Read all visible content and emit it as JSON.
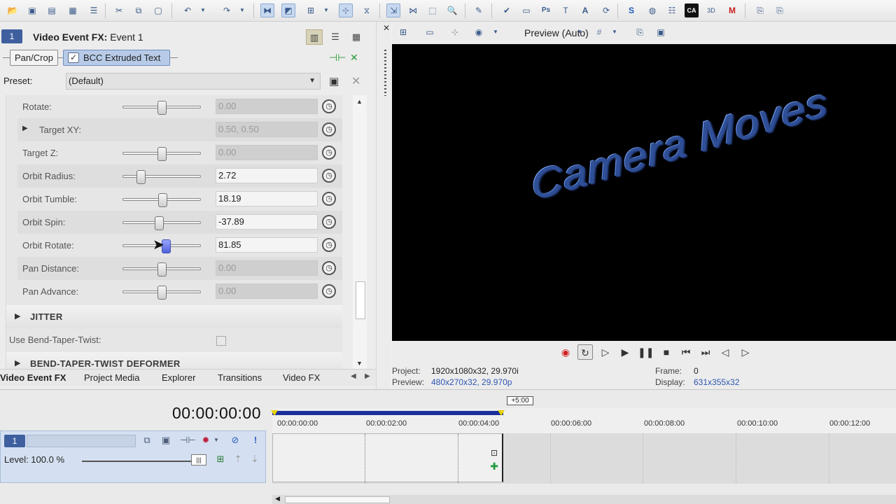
{
  "toolbar": {
    "icons": [
      "open-folder-icon",
      "save-icon",
      "save-as-icon",
      "render-icon",
      "properties-icon",
      "cut-icon",
      "copy-icon",
      "paste-icon",
      "undo-icon",
      "redo-icon",
      "normal-edit-tool-icon",
      "envelope-edit-tool-icon",
      "insert-track-icon",
      "enable-snapping-icon",
      "auto-crossfade-icon",
      "normal-edit-icon",
      "envelope-icon",
      "selection-icon",
      "zoom-icon",
      "paint-icon",
      "check-icon",
      "image-icon",
      "photoshop-icon",
      "text-icon",
      "letter-a-icon",
      "scripting-icon",
      "sony-icon",
      "disc-icon",
      "mixer-icon",
      "ca-icon",
      "3d-icon",
      "m-icon",
      "page-icon",
      "page-icon-2"
    ]
  },
  "left_panel": {
    "track_number": "1",
    "title_bold": "Video Event FX:",
    "title_rest": " Event 1",
    "chain": {
      "pan_crop": "Pan/Crop",
      "bcc": "BCC Extruded Text"
    },
    "preset": {
      "label": "Preset:",
      "value": "(Default)"
    },
    "params": [
      {
        "label": "Rotate:",
        "value": "0.00",
        "disabled": true
      },
      {
        "label": "Target XY:",
        "value": "0.50, 0.50",
        "disabled": true
      },
      {
        "label": "Target Z:",
        "value": "0.00",
        "disabled": true
      },
      {
        "label": "Orbit Radius:",
        "value": "2.72",
        "disabled": false
      },
      {
        "label": "Orbit Tumble:",
        "value": "18.19",
        "disabled": false
      },
      {
        "label": "Orbit Spin:",
        "value": "-37.89",
        "disabled": false
      },
      {
        "label": "Orbit Rotate:",
        "value": "81.85",
        "disabled": false
      },
      {
        "label": "Pan Distance:",
        "value": "0.00",
        "disabled": true
      },
      {
        "label": "Pan Advance:",
        "value": "0.00",
        "disabled": true
      }
    ],
    "jitter_section": "JITTER",
    "bend_label": "Use Bend-Taper-Twist:",
    "bend_section": "BEND-TAPER-TWIST DEFORMER",
    "tabs": [
      "Video Event FX",
      "Project Media",
      "Explorer",
      "Transitions",
      "Video FX"
    ]
  },
  "preview": {
    "mode_label": "Preview (Auto)",
    "overlay_text": "Camera Moves",
    "info": {
      "project_label": "Project:",
      "project_value": "1920x1080x32, 29.970i",
      "preview_label": "Preview:",
      "preview_value": "480x270x32, 29.970p",
      "frame_label": "Frame:",
      "frame_value": "0",
      "display_label": "Display:",
      "display_value": "631x355x32"
    }
  },
  "timeline": {
    "timecode": "00:00:00:00",
    "region_length": "+5:00",
    "ruler_labels": [
      "00:00:00:00",
      "00:00:02:00",
      "00:00:04:00",
      "00:00:06:00",
      "00:00:08:00",
      "00:00:10:00",
      "00:00:12:00"
    ],
    "track": {
      "number": "1",
      "level_label": "Level: 100.0 %",
      "level_value": 1.0
    }
  },
  "colors": {
    "accent": "#3f5f9f",
    "selection": "#b7cbe8",
    "loop_bar": "#1a2f9a",
    "loop_marker": "#e8d200",
    "text_3d": "#4f7fd6"
  }
}
